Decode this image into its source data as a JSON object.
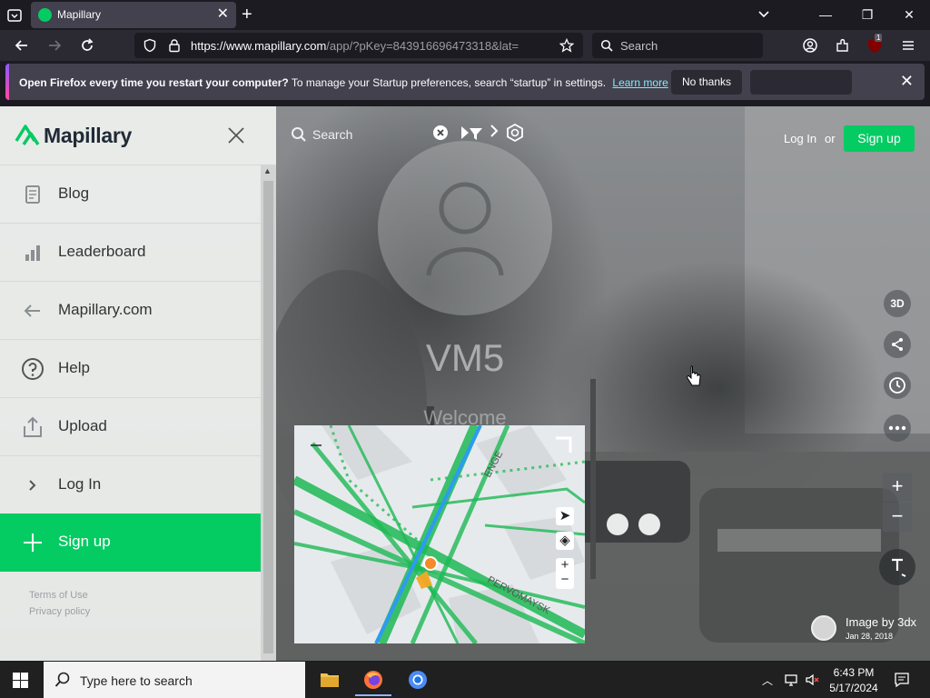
{
  "browser": {
    "tab": {
      "title": "Mapillary"
    },
    "url": {
      "host": "https://www.mapillary.com",
      "path": "/app/?pKey=843916696473318&lat="
    },
    "search_placeholder": "Search",
    "extension_badge": "1",
    "notification": {
      "bold": "Open Firefox every time you restart your computer?",
      "text": "To manage your Startup preferences, search “startup” in settings.",
      "link": "Learn more",
      "dismiss_label": "No thanks"
    }
  },
  "sidebar": {
    "brand": "Mapillary",
    "items": [
      {
        "label": "Blog",
        "icon": "document-icon"
      },
      {
        "label": "Leaderboard",
        "icon": "bar-chart-icon"
      },
      {
        "label": "Mapillary.com",
        "icon": "arrow-left-icon"
      },
      {
        "label": "Help",
        "icon": "help-icon"
      },
      {
        "label": "Upload",
        "icon": "upload-icon"
      },
      {
        "label": "Log In",
        "icon": "chevron-right-icon"
      },
      {
        "label": "Sign up",
        "icon": "plus-icon"
      }
    ],
    "footer": {
      "terms": "Terms of Use",
      "privacy": "Privacy policy"
    }
  },
  "topbar": {
    "search_placeholder": "Search",
    "login": "Log In",
    "or": "or",
    "signup": "Sign up"
  },
  "profile": {
    "username": "VM5",
    "welcome": "Welcome"
  },
  "viewer": {
    "mode_3d": "3D",
    "attribution": "Image by 3dx",
    "capture_date": "Jan 28, 2018"
  },
  "minimap": {
    "street_1": "ENGE",
    "street_2": "PERVOMAYSK"
  },
  "taskbar": {
    "search_placeholder": "Type here to search",
    "time": "6:43 PM",
    "date": "5/17/2024"
  },
  "colors": {
    "brand_green": "#05cb63",
    "browser_dark": "#1c1b22",
    "toolbar": "#2b2a33",
    "sequence_green": "#1db954",
    "selected_sequence_blue": "#2d9bf0",
    "position_marker": "#f58a2a"
  }
}
